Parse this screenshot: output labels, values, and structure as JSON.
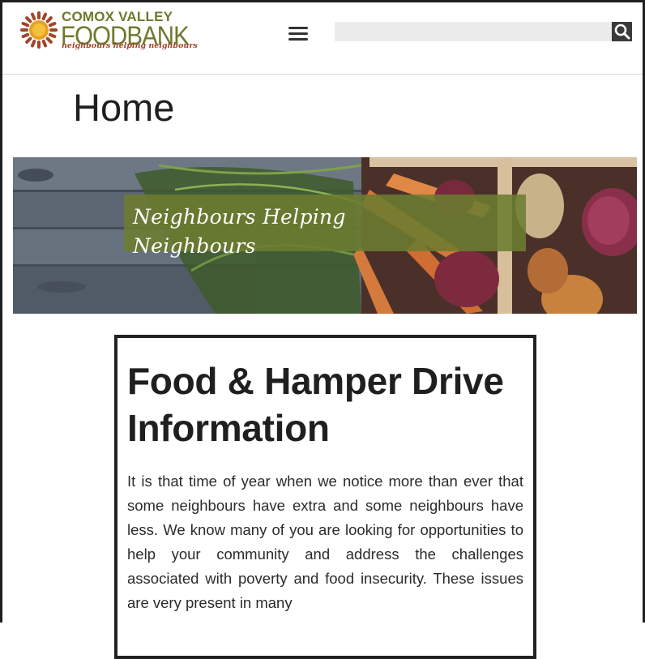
{
  "header": {
    "logo": {
      "line1": "COMOX VALLEY",
      "line2": "FOODBANK",
      "tagline": "neighbours helping neighbours"
    },
    "menu_icon": "hamburger-menu-icon",
    "search": {
      "value": "",
      "placeholder": "",
      "icon": "search-icon"
    }
  },
  "page": {
    "title": "Home"
  },
  "banner": {
    "text_line1": "Neighbours Helping",
    "text_line2": "Neighbours"
  },
  "article": {
    "heading": "Food & Hamper Drive Information",
    "body": "It is that time of year when we notice more than ever that some neighbours have extra and some neighbours have less. We know many of you are looking for opportunities to help your community and address the challenges associated with poverty and food insecurity. These issues are very present in many"
  },
  "colors": {
    "brand_green": "#6c7a2c",
    "brand_rust": "#a0462a",
    "banner_box": "#6c7c30"
  }
}
